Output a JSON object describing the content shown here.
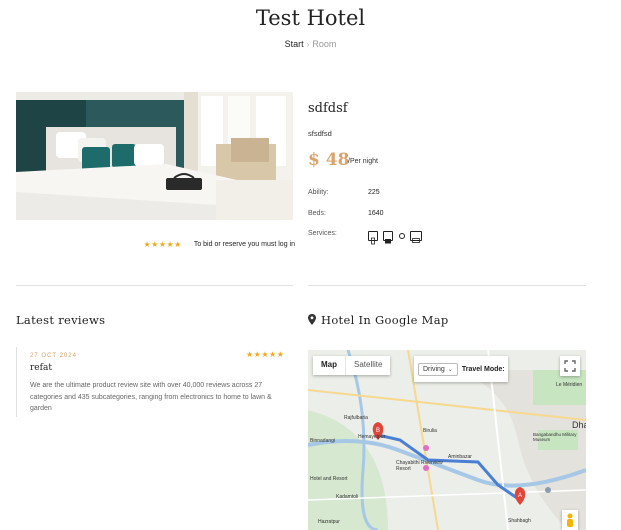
{
  "page": {
    "title": "Test Hotel"
  },
  "breadcrumb": {
    "home": "Start",
    "separator": "›",
    "current": "Room"
  },
  "room": {
    "name": "sdfdsf",
    "description": "sfsdfsd",
    "price": "$ 48",
    "price_unit": "/Per night",
    "ability_label": "Ability:",
    "ability_value": "225",
    "beds_label": "Beds:",
    "beds_value": "1640",
    "services_label": "Services:",
    "services_icons": [
      "phone-icon",
      "camera-icon",
      "dot-icon",
      "monitor-icon"
    ]
  },
  "rating": {
    "stars": "★★★★★",
    "stars_value": 5,
    "bid_text": "To bid or reserve you must log in"
  },
  "reviews": {
    "heading": "Latest reviews",
    "items": [
      {
        "date": "27 OCT 2024",
        "stars": "★★★★★",
        "stars_value": 5,
        "author": "refat",
        "text": "We are the ultimate product review site with over 40,000 reviews across 27 categories and 435 subcategories, ranging from electronics to home to lawn & garden"
      }
    ]
  },
  "map_section": {
    "heading": "Hotel In Google Map",
    "tab_map": "Map",
    "tab_satellite": "Satellite",
    "mode_select": "Driving",
    "travel_mode_label": "Travel Mode:",
    "labels": [
      "Rajfulbaria",
      "Hemayetpur",
      "Birulia",
      "Binnadangi",
      "Aminbazar",
      "Chayabithi Riverview Resort",
      "Hotel and Resort",
      "Kadamtoli",
      "Hazratpur",
      "Bangabandhu Military Museum",
      "Le Méridien",
      "Dhaka",
      "Shahbagh"
    ],
    "marker_a": "A",
    "marker_b": "B",
    "colors": {
      "route": "#4a7fd4",
      "road": "#f6d88f",
      "water": "#a6c8e6",
      "park": "#c7e5c0",
      "marker": "#e0453a"
    }
  }
}
